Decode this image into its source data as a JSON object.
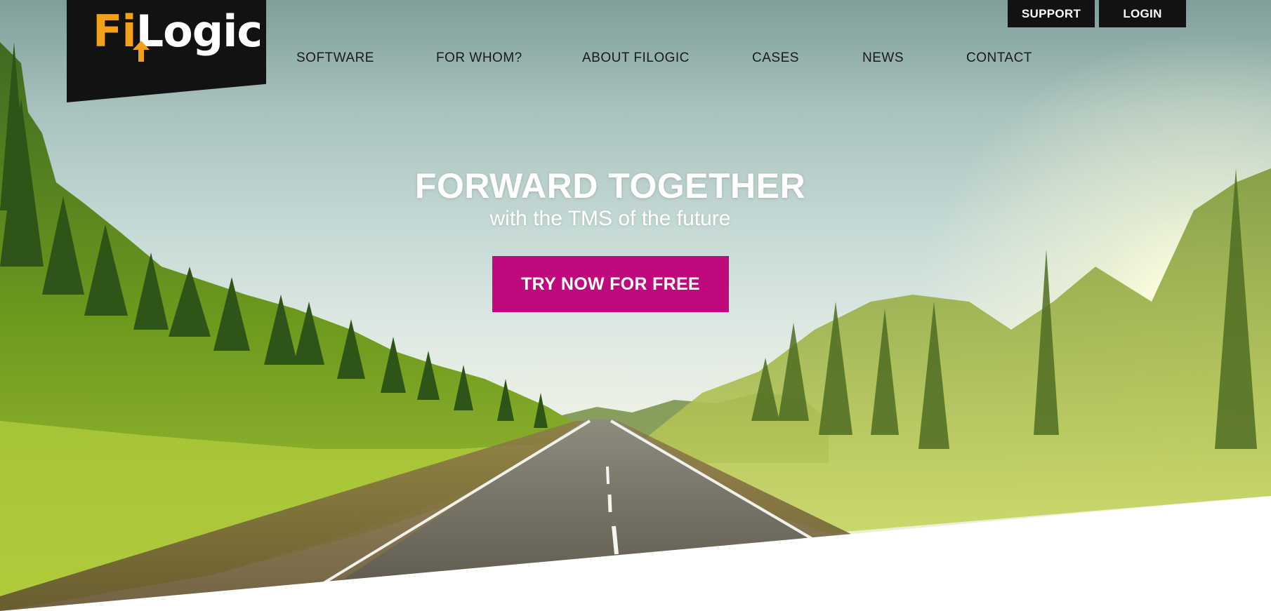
{
  "brand": {
    "logo_part_1": "Fi",
    "logo_part_2": "Logic",
    "colors": {
      "logo_accent": "#f4a11a",
      "dark": "#121212",
      "cta": "#be0a7c"
    }
  },
  "utility_nav": {
    "support_label": "SUPPORT",
    "login_label": "LOGIN"
  },
  "nav": {
    "items": [
      {
        "label": "SOFTWARE"
      },
      {
        "label": "FOR WHOM?"
      },
      {
        "label": "ABOUT FILOGIC"
      },
      {
        "label": "CASES"
      },
      {
        "label": "NEWS"
      },
      {
        "label": "CONTACT"
      }
    ]
  },
  "hero": {
    "title": "FORWARD TOGETHER",
    "subtitle": "with the TMS of the future",
    "cta_label": "TRY NOW FOR FREE"
  },
  "icons": {
    "logo_arrow": "arrow-up-icon"
  }
}
